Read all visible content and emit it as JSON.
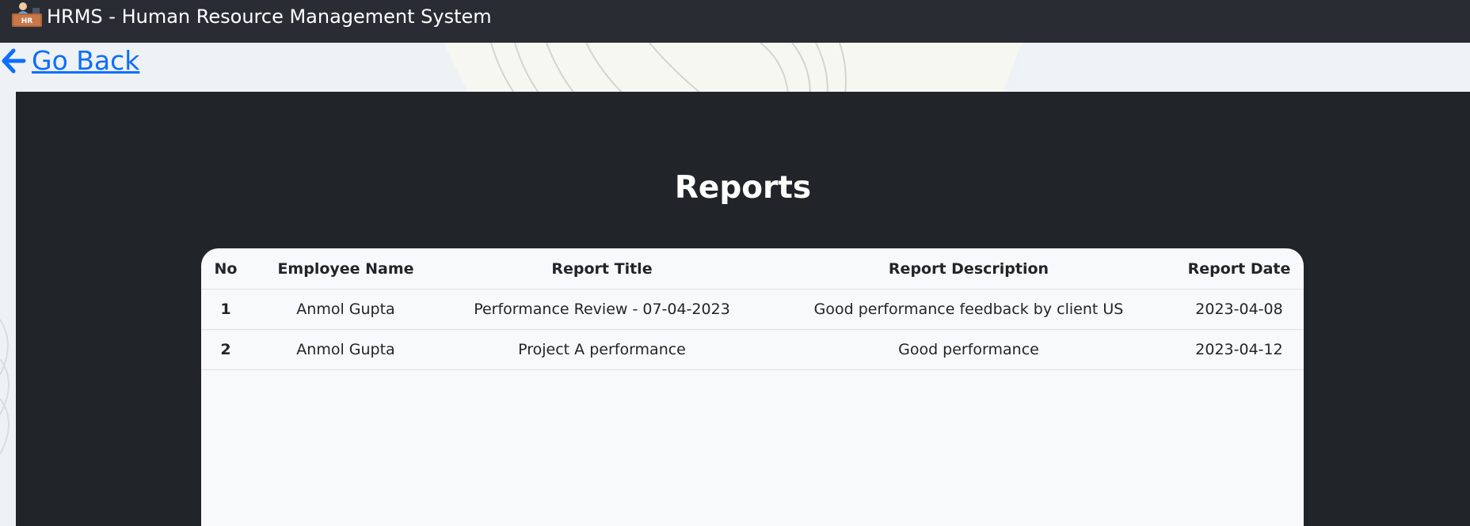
{
  "app": {
    "logo_icon": "hr-desk-icon",
    "title": "HRMS - Human Resource Management System"
  },
  "nav": {
    "back_icon": "arrow-left-icon",
    "back_label": " Go Back"
  },
  "page": {
    "heading": "Reports"
  },
  "table": {
    "headers": {
      "no": "No",
      "employee_name": "Employee Name",
      "report_title": "Report Title",
      "report_description": "Report Description",
      "report_date": "Report Date"
    },
    "rows": [
      {
        "no": "1",
        "employee_name": "Anmol Gupta",
        "report_title": "Performance Review - 07-04-2023",
        "report_description": "Good performance feedback by client US",
        "report_date": "2023-04-08"
      },
      {
        "no": "2",
        "employee_name": "Anmol Gupta",
        "report_title": "Project A performance",
        "report_description": "Good performance",
        "report_date": "2023-04-12"
      }
    ]
  },
  "colors": {
    "topbar": "#292d33",
    "panel": "#212529",
    "table_bg": "#f8f9fa",
    "link": "#0d6efd"
  }
}
